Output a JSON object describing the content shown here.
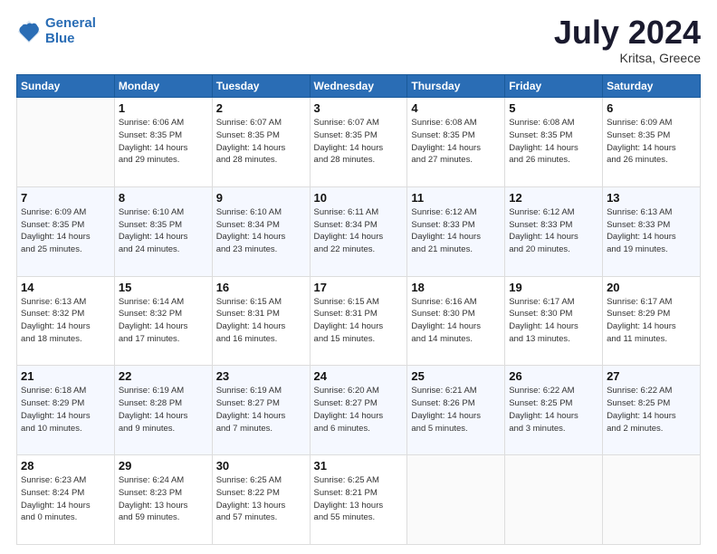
{
  "header": {
    "logo_line1": "General",
    "logo_line2": "Blue",
    "month_year": "July 2024",
    "location": "Kritsa, Greece"
  },
  "weekdays": [
    "Sunday",
    "Monday",
    "Tuesday",
    "Wednesday",
    "Thursday",
    "Friday",
    "Saturday"
  ],
  "weeks": [
    [
      {
        "day": "",
        "sunrise": "",
        "sunset": "",
        "daylight": ""
      },
      {
        "day": "1",
        "sunrise": "Sunrise: 6:06 AM",
        "sunset": "Sunset: 8:35 PM",
        "daylight": "Daylight: 14 hours and 29 minutes."
      },
      {
        "day": "2",
        "sunrise": "Sunrise: 6:07 AM",
        "sunset": "Sunset: 8:35 PM",
        "daylight": "Daylight: 14 hours and 28 minutes."
      },
      {
        "day": "3",
        "sunrise": "Sunrise: 6:07 AM",
        "sunset": "Sunset: 8:35 PM",
        "daylight": "Daylight: 14 hours and 28 minutes."
      },
      {
        "day": "4",
        "sunrise": "Sunrise: 6:08 AM",
        "sunset": "Sunset: 8:35 PM",
        "daylight": "Daylight: 14 hours and 27 minutes."
      },
      {
        "day": "5",
        "sunrise": "Sunrise: 6:08 AM",
        "sunset": "Sunset: 8:35 PM",
        "daylight": "Daylight: 14 hours and 26 minutes."
      },
      {
        "day": "6",
        "sunrise": "Sunrise: 6:09 AM",
        "sunset": "Sunset: 8:35 PM",
        "daylight": "Daylight: 14 hours and 26 minutes."
      }
    ],
    [
      {
        "day": "7",
        "sunrise": "Sunrise: 6:09 AM",
        "sunset": "Sunset: 8:35 PM",
        "daylight": "Daylight: 14 hours and 25 minutes."
      },
      {
        "day": "8",
        "sunrise": "Sunrise: 6:10 AM",
        "sunset": "Sunset: 8:35 PM",
        "daylight": "Daylight: 14 hours and 24 minutes."
      },
      {
        "day": "9",
        "sunrise": "Sunrise: 6:10 AM",
        "sunset": "Sunset: 8:34 PM",
        "daylight": "Daylight: 14 hours and 23 minutes."
      },
      {
        "day": "10",
        "sunrise": "Sunrise: 6:11 AM",
        "sunset": "Sunset: 8:34 PM",
        "daylight": "Daylight: 14 hours and 22 minutes."
      },
      {
        "day": "11",
        "sunrise": "Sunrise: 6:12 AM",
        "sunset": "Sunset: 8:33 PM",
        "daylight": "Daylight: 14 hours and 21 minutes."
      },
      {
        "day": "12",
        "sunrise": "Sunrise: 6:12 AM",
        "sunset": "Sunset: 8:33 PM",
        "daylight": "Daylight: 14 hours and 20 minutes."
      },
      {
        "day": "13",
        "sunrise": "Sunrise: 6:13 AM",
        "sunset": "Sunset: 8:33 PM",
        "daylight": "Daylight: 14 hours and 19 minutes."
      }
    ],
    [
      {
        "day": "14",
        "sunrise": "Sunrise: 6:13 AM",
        "sunset": "Sunset: 8:32 PM",
        "daylight": "Daylight: 14 hours and 18 minutes."
      },
      {
        "day": "15",
        "sunrise": "Sunrise: 6:14 AM",
        "sunset": "Sunset: 8:32 PM",
        "daylight": "Daylight: 14 hours and 17 minutes."
      },
      {
        "day": "16",
        "sunrise": "Sunrise: 6:15 AM",
        "sunset": "Sunset: 8:31 PM",
        "daylight": "Daylight: 14 hours and 16 minutes."
      },
      {
        "day": "17",
        "sunrise": "Sunrise: 6:15 AM",
        "sunset": "Sunset: 8:31 PM",
        "daylight": "Daylight: 14 hours and 15 minutes."
      },
      {
        "day": "18",
        "sunrise": "Sunrise: 6:16 AM",
        "sunset": "Sunset: 8:30 PM",
        "daylight": "Daylight: 14 hours and 14 minutes."
      },
      {
        "day": "19",
        "sunrise": "Sunrise: 6:17 AM",
        "sunset": "Sunset: 8:30 PM",
        "daylight": "Daylight: 14 hours and 13 minutes."
      },
      {
        "day": "20",
        "sunrise": "Sunrise: 6:17 AM",
        "sunset": "Sunset: 8:29 PM",
        "daylight": "Daylight: 14 hours and 11 minutes."
      }
    ],
    [
      {
        "day": "21",
        "sunrise": "Sunrise: 6:18 AM",
        "sunset": "Sunset: 8:29 PM",
        "daylight": "Daylight: 14 hours and 10 minutes."
      },
      {
        "day": "22",
        "sunrise": "Sunrise: 6:19 AM",
        "sunset": "Sunset: 8:28 PM",
        "daylight": "Daylight: 14 hours and 9 minutes."
      },
      {
        "day": "23",
        "sunrise": "Sunrise: 6:19 AM",
        "sunset": "Sunset: 8:27 PM",
        "daylight": "Daylight: 14 hours and 7 minutes."
      },
      {
        "day": "24",
        "sunrise": "Sunrise: 6:20 AM",
        "sunset": "Sunset: 8:27 PM",
        "daylight": "Daylight: 14 hours and 6 minutes."
      },
      {
        "day": "25",
        "sunrise": "Sunrise: 6:21 AM",
        "sunset": "Sunset: 8:26 PM",
        "daylight": "Daylight: 14 hours and 5 minutes."
      },
      {
        "day": "26",
        "sunrise": "Sunrise: 6:22 AM",
        "sunset": "Sunset: 8:25 PM",
        "daylight": "Daylight: 14 hours and 3 minutes."
      },
      {
        "day": "27",
        "sunrise": "Sunrise: 6:22 AM",
        "sunset": "Sunset: 8:25 PM",
        "daylight": "Daylight: 14 hours and 2 minutes."
      }
    ],
    [
      {
        "day": "28",
        "sunrise": "Sunrise: 6:23 AM",
        "sunset": "Sunset: 8:24 PM",
        "daylight": "Daylight: 14 hours and 0 minutes."
      },
      {
        "day": "29",
        "sunrise": "Sunrise: 6:24 AM",
        "sunset": "Sunset: 8:23 PM",
        "daylight": "Daylight: 13 hours and 59 minutes."
      },
      {
        "day": "30",
        "sunrise": "Sunrise: 6:25 AM",
        "sunset": "Sunset: 8:22 PM",
        "daylight": "Daylight: 13 hours and 57 minutes."
      },
      {
        "day": "31",
        "sunrise": "Sunrise: 6:25 AM",
        "sunset": "Sunset: 8:21 PM",
        "daylight": "Daylight: 13 hours and 55 minutes."
      },
      {
        "day": "",
        "sunrise": "",
        "sunset": "",
        "daylight": ""
      },
      {
        "day": "",
        "sunrise": "",
        "sunset": "",
        "daylight": ""
      },
      {
        "day": "",
        "sunrise": "",
        "sunset": "",
        "daylight": ""
      }
    ]
  ]
}
